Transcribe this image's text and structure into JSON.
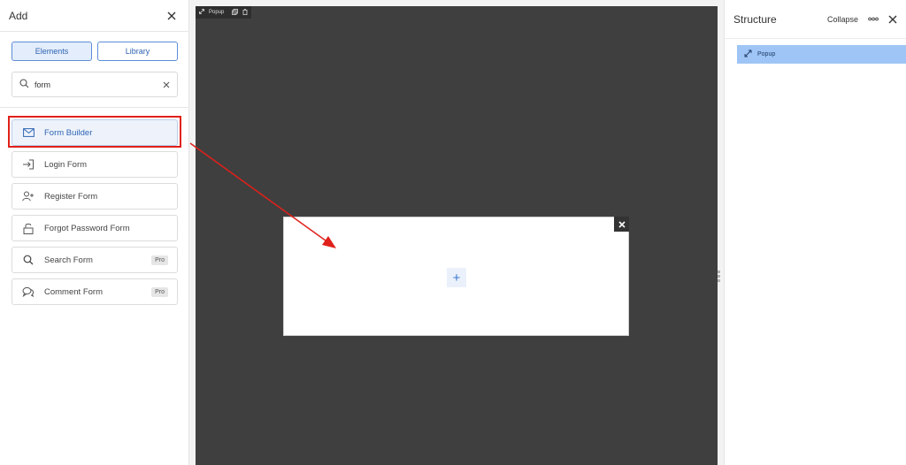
{
  "left_panel": {
    "title": "Add",
    "tabs": [
      {
        "label": "Elements",
        "active": true
      },
      {
        "label": "Library",
        "active": false
      }
    ],
    "search": {
      "value": "form",
      "placeholder": ""
    },
    "items": [
      {
        "label": "Form Builder",
        "icon": "envelope-icon",
        "pro": "",
        "selected": true
      },
      {
        "label": "Login Form",
        "icon": "login-icon",
        "pro": ""
      },
      {
        "label": "Register Form",
        "icon": "user-plus-icon",
        "pro": ""
      },
      {
        "label": "Forgot Password Form",
        "icon": "unlock-icon",
        "pro": ""
      },
      {
        "label": "Search Form",
        "icon": "search-icon",
        "pro": "Pro"
      },
      {
        "label": "Comment Form",
        "icon": "comment-icon",
        "pro": "Pro"
      }
    ]
  },
  "canvas": {
    "tag_label": "Popup",
    "popup_add_symbol": "+"
  },
  "right_panel": {
    "title": "Structure",
    "collapse_label": "Collapse",
    "tree": [
      {
        "label": "Popup",
        "icon": "expand-icon"
      }
    ]
  },
  "colors": {
    "accent": "#2f64b3",
    "highlight_red": "#e0201a",
    "canvas_bg": "#3f3f3f",
    "tree_selected": "#9ec5f5"
  }
}
